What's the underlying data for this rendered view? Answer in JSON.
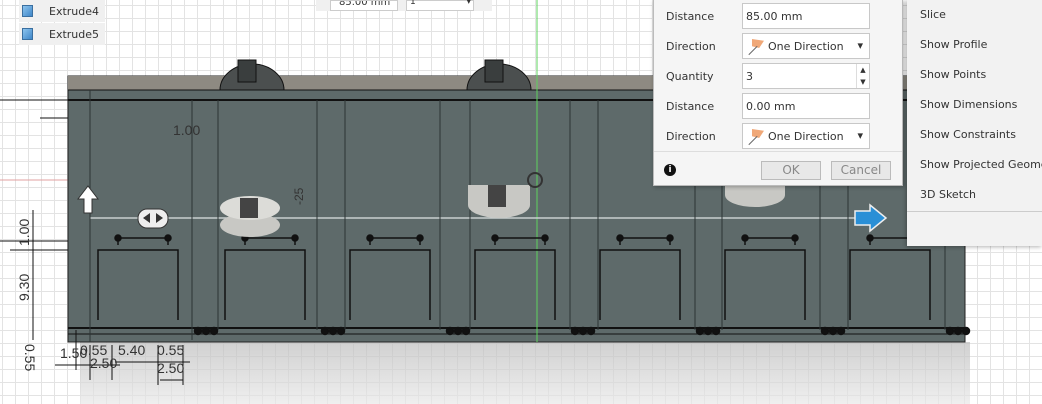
{
  "browser": {
    "items": [
      {
        "label": "Extrude4"
      },
      {
        "label": "Extrude5"
      }
    ]
  },
  "topbar": {
    "field_value": "85.00 mm",
    "select_value": "1"
  },
  "dialog": {
    "rows": [
      {
        "label": "Distance",
        "value": "85.00 mm"
      },
      {
        "label": "Direction",
        "value": "One Direction"
      },
      {
        "label": "Quantity",
        "value": "3"
      },
      {
        "label": "Distance",
        "value": "0.00 mm"
      },
      {
        "label": "Direction",
        "value": "One Direction"
      }
    ],
    "ok_label": "OK",
    "cancel_label": "Cancel",
    "info_icon": "i"
  },
  "menu": {
    "items": [
      "Slice",
      "Show Profile",
      "Show Points",
      "Show Dimensions",
      "Show Constraints",
      "Show Projected Geometries",
      "3D Sketch"
    ]
  },
  "dimensions": {
    "top": "1.00",
    "angle": "-25",
    "left_top": "1.00",
    "left_mid": "9.30",
    "left_bottom": "0.55",
    "b1": "1.50",
    "b2": "0.55",
    "b3": "2.50",
    "b4": "5.40",
    "b5": "0.55",
    "b6": "2.50"
  },
  "colors": {
    "body": "#5e6a6a",
    "accent": "#2a8fd6",
    "axis_green": "#5fd35f"
  }
}
